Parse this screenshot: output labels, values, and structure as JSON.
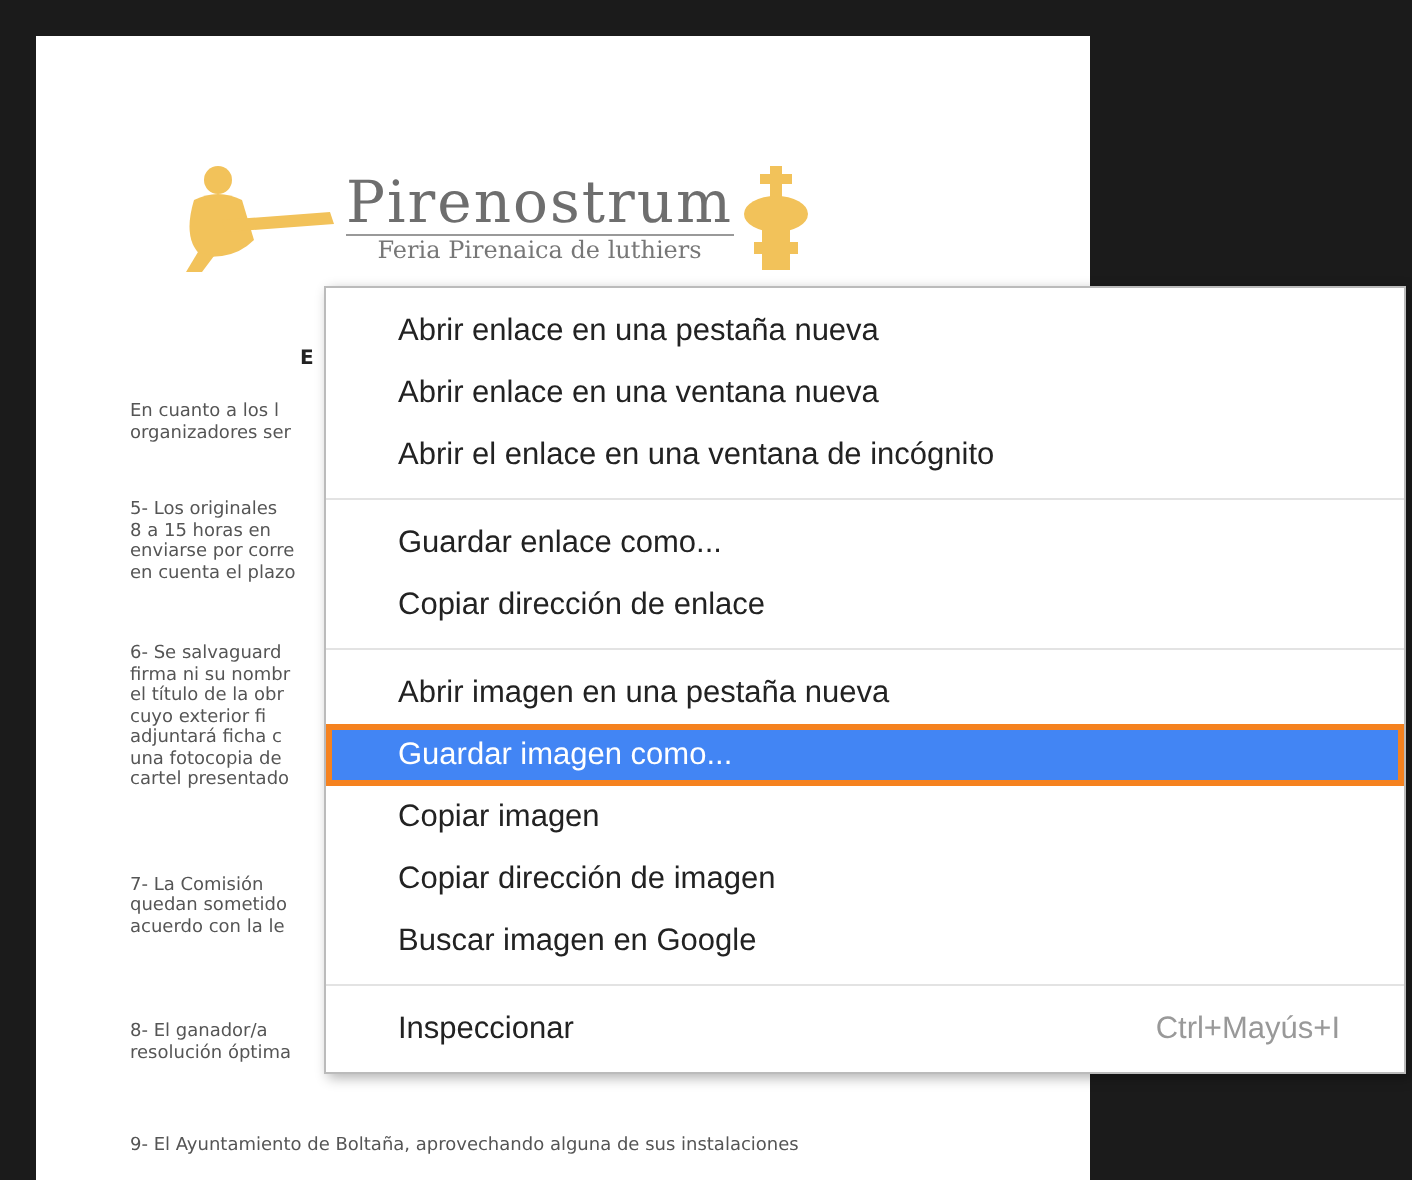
{
  "document": {
    "logo_title": "Pirenostrum",
    "logo_subtitle": "Feria Pirenaica de luthiers",
    "heading": "E",
    "paragraphs": [
      {
        "lines": [
          "En cuanto a los l",
          "organizadores ser"
        ]
      },
      {
        "lines": [
          "5- Los originales",
          "8 a 15 horas en",
          "enviarse por corre",
          "en cuenta el plazo"
        ]
      },
      {
        "lines": [
          "6- Se salvaguard",
          "firma ni su nombr",
          "el título de la obr",
          "cuyo exterior fi",
          "adjuntará ficha c",
          "una fotocopia de",
          "cartel presentado"
        ]
      },
      {
        "lines": [
          "7- La Comisión",
          "quedan sometido",
          "acuerdo con la le"
        ]
      },
      {
        "lines": [
          "8- El ganador/a",
          "resolución óptima"
        ]
      },
      {
        "lines": [
          "9- El Ayuntamiento de Boltaña, aprovechando alguna de sus instalaciones"
        ]
      }
    ]
  },
  "context_menu": {
    "groups": [
      {
        "items": [
          {
            "label": "Abrir enlace en una pestaña nueva",
            "selected": false
          },
          {
            "label": "Abrir enlace en una ventana nueva",
            "selected": false
          },
          {
            "label": "Abrir el enlace en una ventana de incógnito",
            "selected": false
          }
        ]
      },
      {
        "items": [
          {
            "label": "Guardar enlace como...",
            "selected": false
          },
          {
            "label": "Copiar dirección de enlace",
            "selected": false
          }
        ]
      },
      {
        "items": [
          {
            "label": "Abrir imagen en una pestaña nueva",
            "selected": false
          },
          {
            "label": "Guardar imagen como...",
            "selected": true
          },
          {
            "label": "Copiar imagen",
            "selected": false
          },
          {
            "label": "Copiar dirección de imagen",
            "selected": false
          },
          {
            "label": "Buscar imagen en Google",
            "selected": false
          }
        ]
      },
      {
        "items": [
          {
            "label": "Inspeccionar",
            "shortcut": "Ctrl+Mayús+I",
            "selected": false
          }
        ]
      }
    ]
  }
}
